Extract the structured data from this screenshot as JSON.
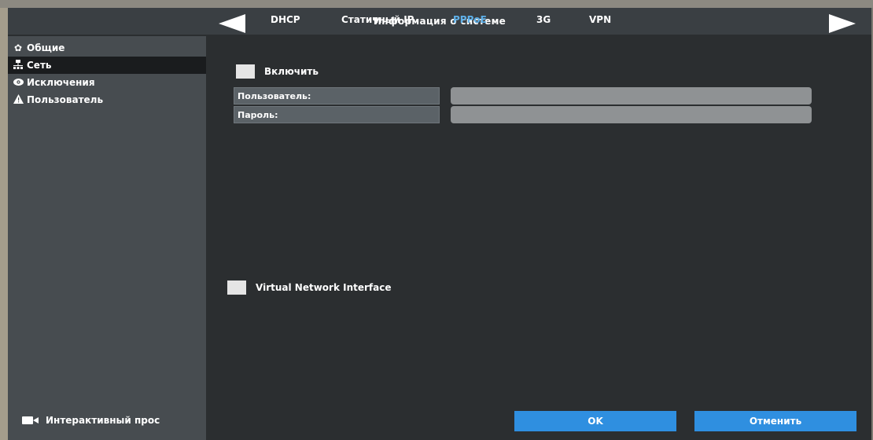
{
  "window": {
    "title": "Информация о системе"
  },
  "sidebar": {
    "items": [
      {
        "label": "Общие",
        "icon": "gear-icon"
      },
      {
        "label": "Сеть",
        "icon": "network-icon"
      },
      {
        "label": "Исключения",
        "icon": "eye-icon"
      },
      {
        "label": "Пользователь",
        "icon": "warning-icon"
      }
    ],
    "active_index": 1,
    "live_view_label": "Интерактивный прос"
  },
  "tabs": {
    "items": [
      "DHCP",
      "Статичный IP",
      "PPPoE",
      "3G",
      "VPN"
    ],
    "active": "PPPoE"
  },
  "pppoe": {
    "enable_label": "Включить",
    "enabled": false,
    "user_label": "Пользователь:",
    "user_value": "",
    "password_label": "Пароль:",
    "password_value": ""
  },
  "vni": {
    "label": "Virtual Network Interface",
    "enabled": false
  },
  "buttons": {
    "ok": "OK",
    "cancel": "Отменить"
  },
  "colors": {
    "accent": "#2f8fe0",
    "active_tab": "#5fb0e8",
    "sidebar_active": "#1a1c1e"
  }
}
